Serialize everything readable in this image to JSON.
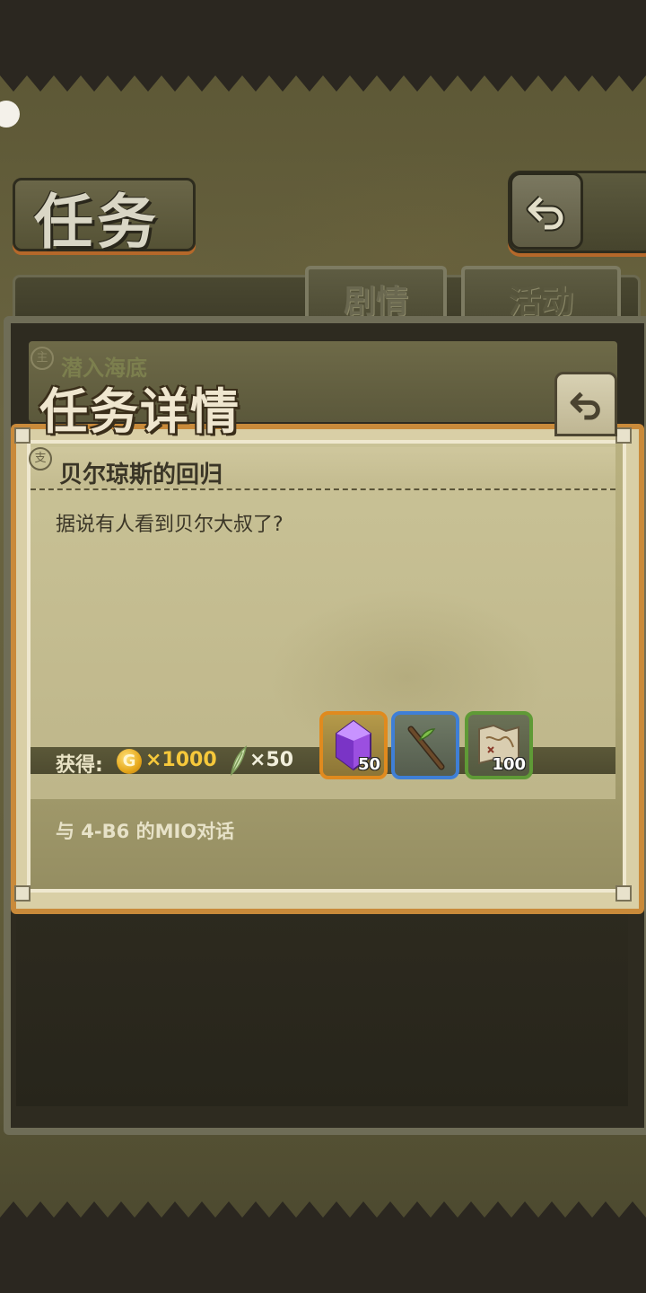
{
  "header": {
    "title": "任务",
    "back_icon": "return-arrow-icon"
  },
  "tabs": [
    {
      "label": "剧情",
      "state": "selected"
    },
    {
      "label": "活动",
      "state": "normal"
    }
  ],
  "list": {
    "item_badge": "主",
    "item_title": "潜入海底"
  },
  "modal": {
    "title": "任务详情",
    "back_icon": "return-arrow-icon",
    "quest_badge": "支",
    "quest_name": "贝尔琼斯的回归",
    "description": "据说有人看到贝尔大叔了?",
    "reward_label": "获得:",
    "coin_symbol": "G",
    "coin_amount": "×1000",
    "feather_amount": "×50",
    "items": [
      {
        "icon": "purple-crystal-icon",
        "count": "50",
        "rarity_color": "#e08a1e"
      },
      {
        "icon": "wooden-branch-icon",
        "count": "",
        "rarity_color": "#3f7fd6"
      },
      {
        "icon": "treasure-map-scroll-icon",
        "count": "100",
        "rarity_color": "#5f9a36"
      }
    ],
    "objective": "与 4-B6 的MIO对话"
  }
}
